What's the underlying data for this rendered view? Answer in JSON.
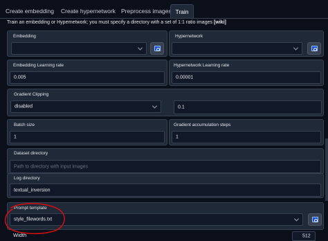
{
  "tabs": [
    {
      "label": "Create embedding"
    },
    {
      "label": "Create hypernetwork"
    },
    {
      "label": "Preprocess images"
    },
    {
      "label": "Train"
    }
  ],
  "intro": {
    "text": "Train an embedding or Hypernetwork; you must specify a directory with a set of 1:1 ratio images",
    "link": "[wiki]"
  },
  "fields": {
    "embedding": {
      "label": "Embedding",
      "value": ""
    },
    "hypernetwork": {
      "label": "Hypernetwork",
      "value": ""
    },
    "embedding_lr": {
      "label": "Embedding Learning rate",
      "value": "0.005"
    },
    "hypernetwork_lr": {
      "label": "Hypernetwork Learning rate",
      "value": "0.00001"
    },
    "gradient_clipping": {
      "label": "Gradient Clipping",
      "value": "disabled",
      "amount": "0.1"
    },
    "batch_size": {
      "label": "Batch size",
      "value": "1"
    },
    "grad_accum": {
      "label": "Gradient accumulation steps",
      "value": "1"
    },
    "dataset_dir": {
      "label": "Dataset directory",
      "placeholder": "Path to directory with input images"
    },
    "log_dir": {
      "label": "Log directory",
      "value": "textual_inversion"
    },
    "prompt_template": {
      "label": "Prompt template",
      "value": "style_filewords.txt"
    },
    "width": {
      "label": "Width",
      "value": "512"
    }
  },
  "colors": {
    "background": "#0b0f19",
    "panel": "#1f2937",
    "input": "#111827",
    "annotation": "#d01010"
  },
  "icons": {
    "refresh": "refresh-icon"
  }
}
